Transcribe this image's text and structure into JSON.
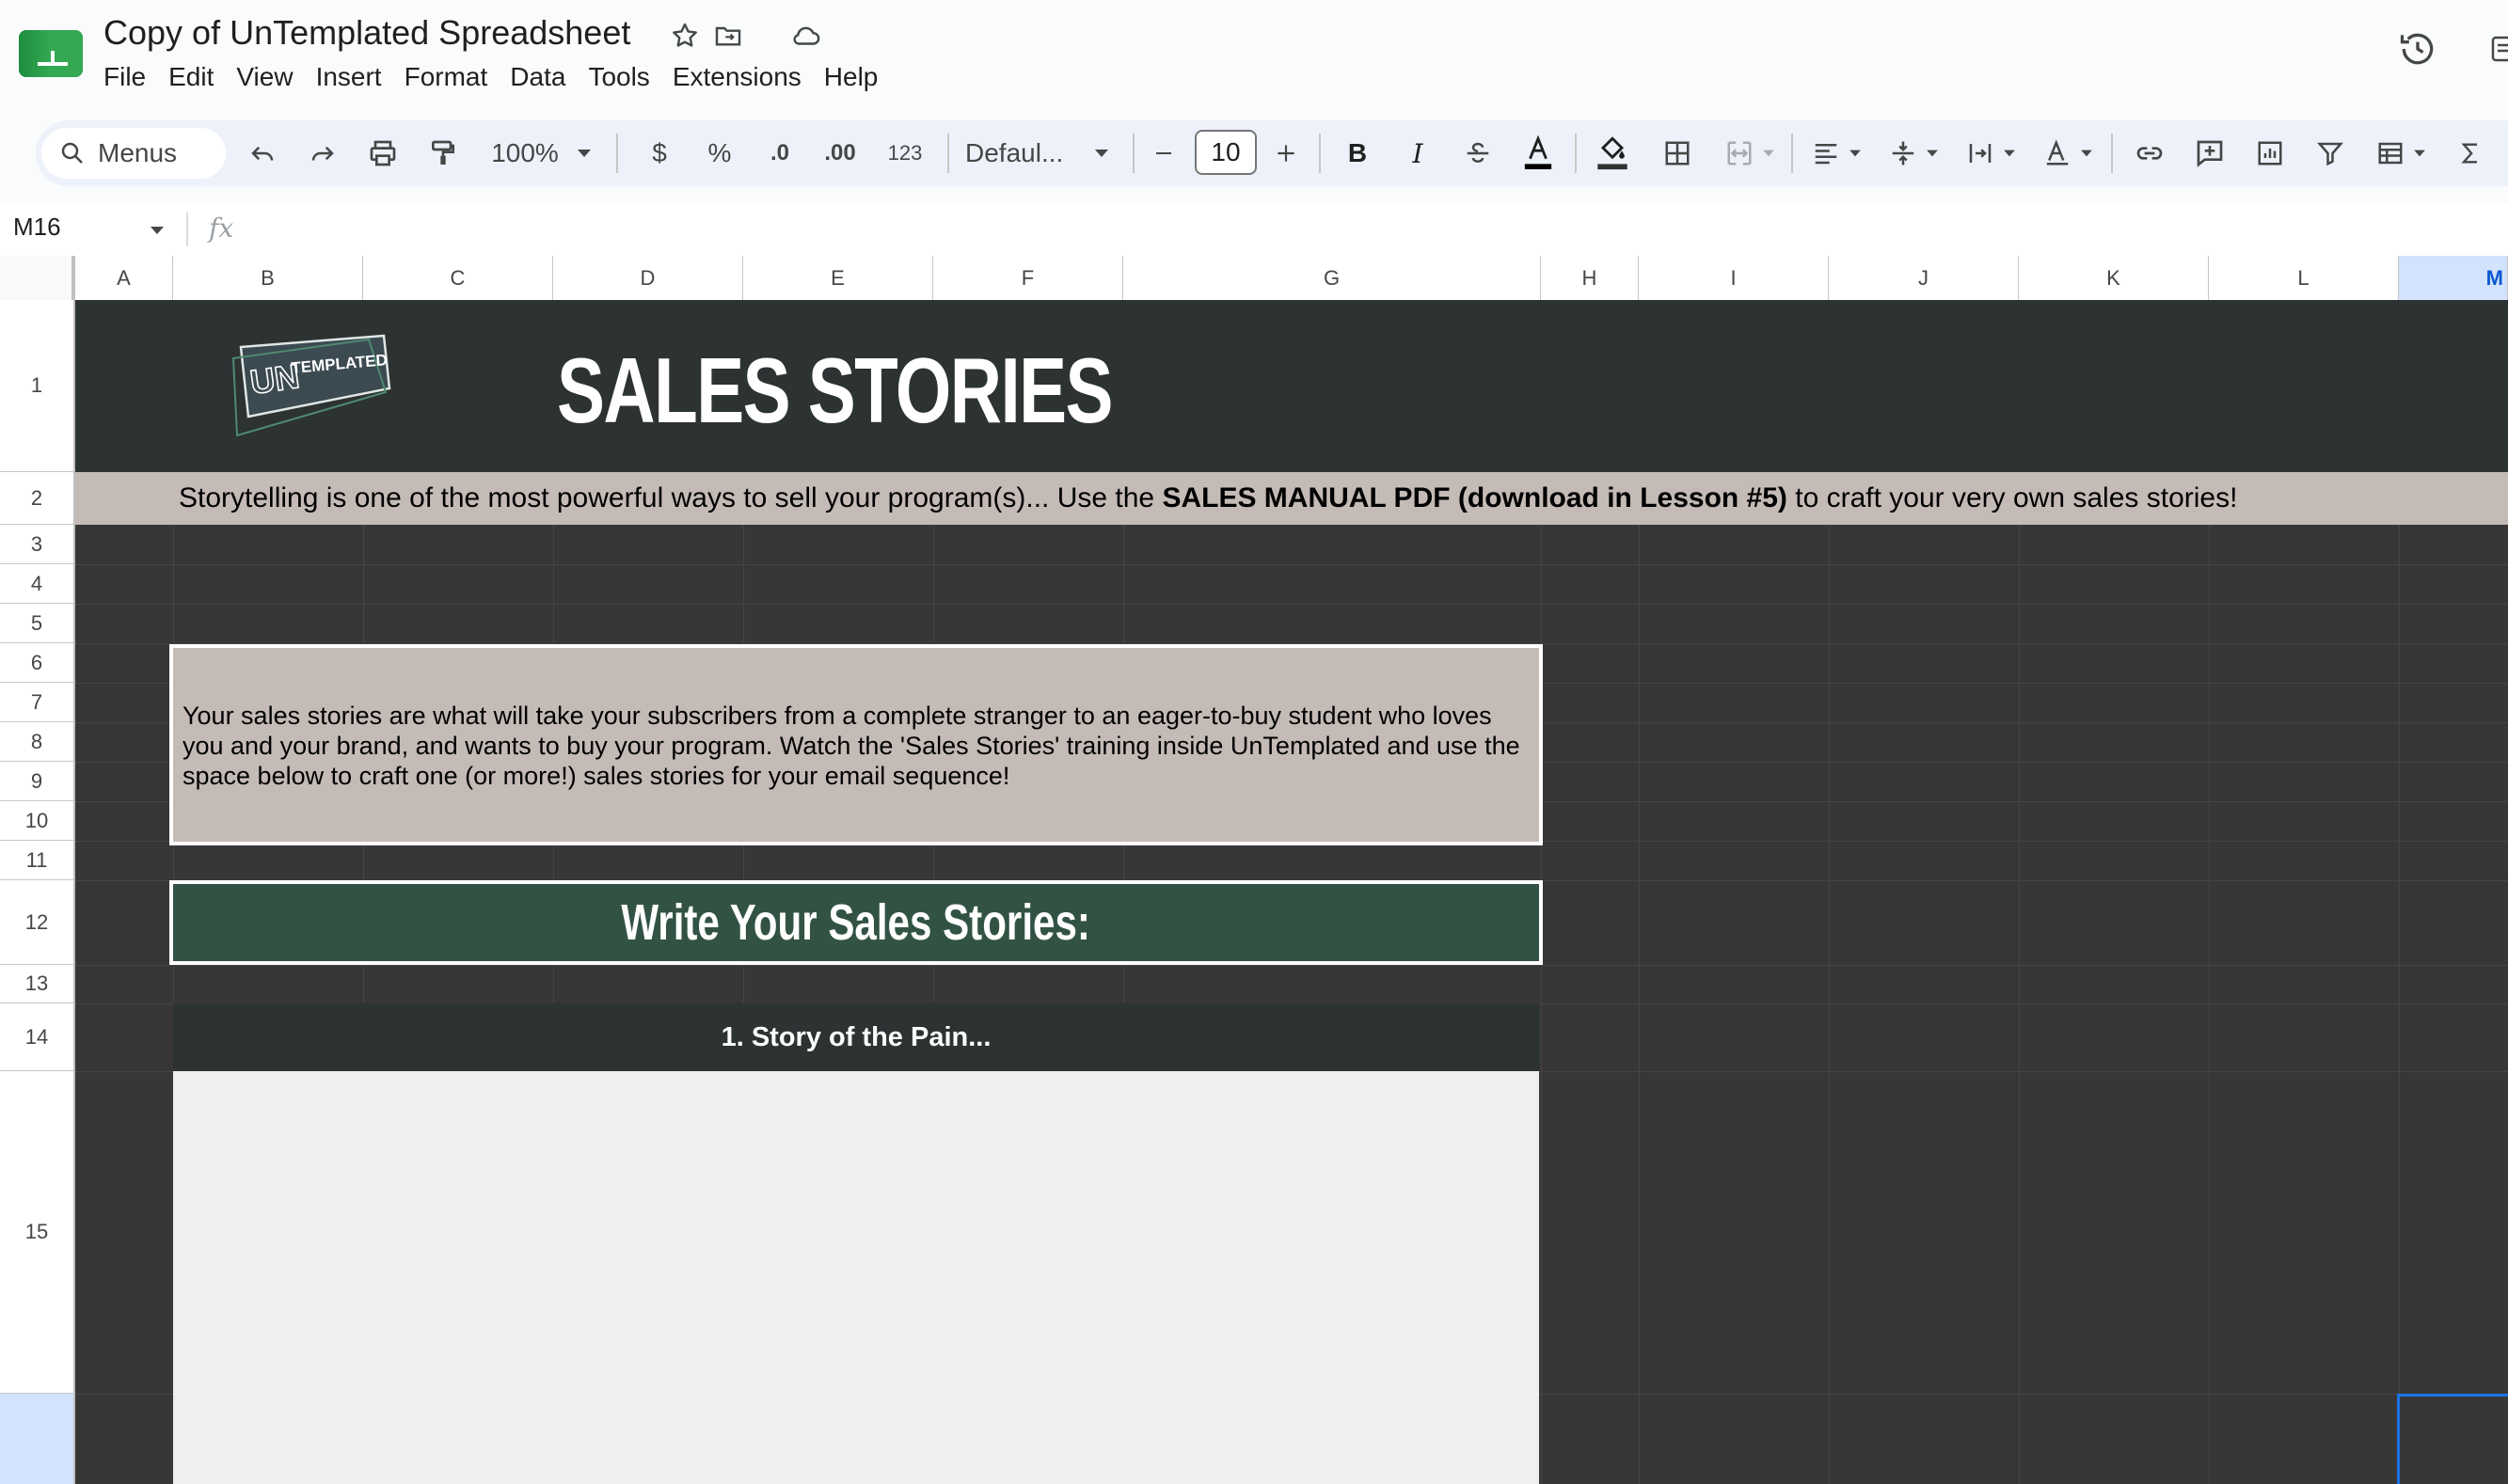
{
  "app": {
    "doc_title": "Copy of UnTemplated Spreadsheet",
    "menu": [
      "File",
      "Edit",
      "View",
      "Insert",
      "Format",
      "Data",
      "Tools",
      "Extensions",
      "Help"
    ]
  },
  "toolbar": {
    "search_label": "Menus",
    "zoom": "100%",
    "currency": "$",
    "percent": "%",
    "decrease_decimal": ".0",
    "increase_decimal": ".00",
    "number_format": "123",
    "font": "Defaul...",
    "font_size": "10",
    "bold": "B",
    "italic": "I"
  },
  "formula_bar": {
    "cell_ref": "M16",
    "fx": "fx"
  },
  "columns": [
    "A",
    "B",
    "C",
    "D",
    "E",
    "F",
    "G",
    "H",
    "I",
    "J",
    "K",
    "L",
    "M"
  ],
  "rows": [
    "1",
    "2",
    "3",
    "4",
    "5",
    "6",
    "7",
    "8",
    "9",
    "10",
    "11",
    "12",
    "13",
    "14",
    "15",
    ""
  ],
  "sheet": {
    "logo_text_un": "UN",
    "logo_text_templated": "TEMPLATED",
    "title": "SALES STORIES",
    "banner_pre": "Storytelling is one of the most powerful ways to sell your program(s)... Use the ",
    "banner_bold": "SALES MANUAL PDF (download in Lesson #5)",
    "banner_post": " to craft your very own sales stories!",
    "intro": "Your sales stories are what will take your subscribers from a complete stranger to an eager-to-buy student who loves you and your brand, and wants to buy your program. Watch the 'Sales Stories' training inside UnTemplated and use the space below to craft one (or more!) sales stories for your email sequence!",
    "section_title": "Write Your Sales Stories:",
    "story_1_title": "1. Story of the Pain..."
  },
  "colors": {
    "dark_band": "#2d3233",
    "taupe": "#c4bbb6",
    "green": "#325343",
    "grid_bg": "#373737"
  }
}
